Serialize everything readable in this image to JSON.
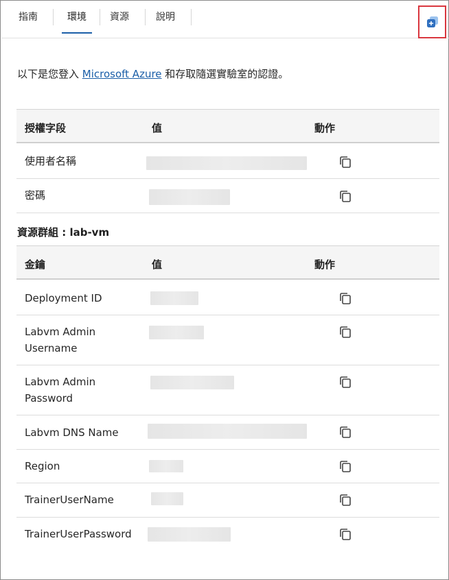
{
  "tabs": [
    {
      "label": "指南"
    },
    {
      "label": "環境"
    },
    {
      "label": "資源"
    },
    {
      "label": "說明"
    }
  ],
  "active_tab": "環境",
  "intro": {
    "before": "以下是您登入 ",
    "link": "Microsoft Azure",
    "after": " 和存取隨選實驗室的認證。"
  },
  "auth_table": {
    "headers": [
      "授權字段",
      "值",
      "動作"
    ],
    "rows": [
      {
        "label": "使用者名稱"
      },
      {
        "label": "密碼"
      }
    ]
  },
  "resource_group": {
    "title": "資源群組 : lab-vm"
  },
  "key_table": {
    "headers": [
      "金鑰",
      "值",
      "動作"
    ],
    "rows": [
      {
        "label": "Deployment ID"
      },
      {
        "label": "Labvm Admin Username"
      },
      {
        "label": "Labvm Admin Password"
      },
      {
        "label": "Labvm DNS Name"
      },
      {
        "label": "Region"
      },
      {
        "label": "TrainerUserName"
      },
      {
        "label": "TrainerUserPassword"
      }
    ]
  },
  "icons": {
    "copy": "copy-icon",
    "popout": "popout-icon"
  },
  "colors": {
    "accent": "#1a5ea8",
    "highlight_border": "#d9363e",
    "header_bg": "#f5f5f5",
    "masked_value": "#e8e8e8"
  }
}
